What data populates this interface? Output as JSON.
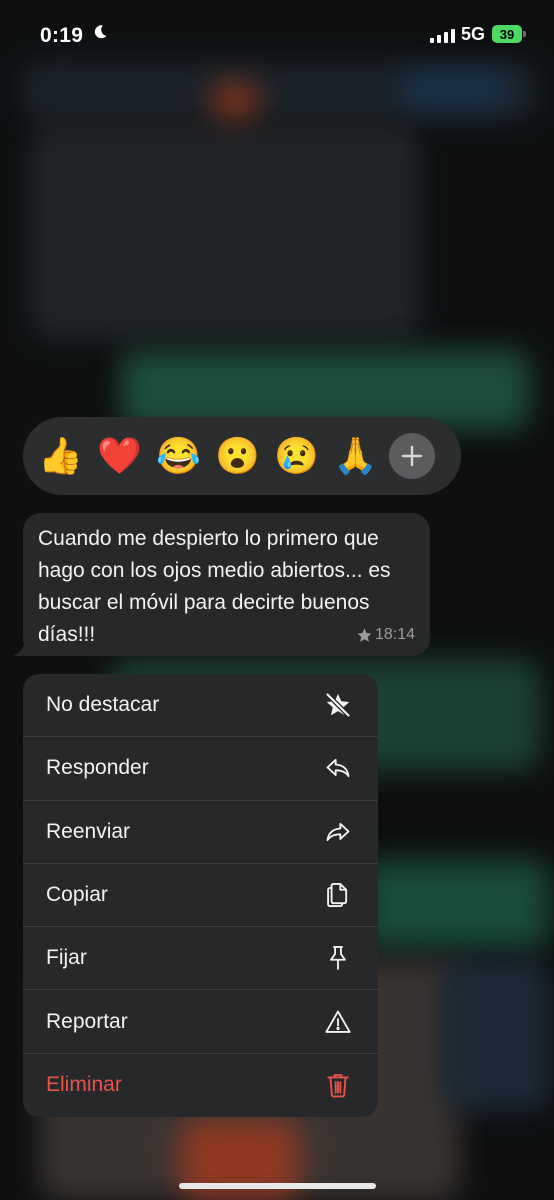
{
  "status_bar": {
    "time": "0:19",
    "network": "5G",
    "battery": "39"
  },
  "reactions": [
    {
      "emoji": "👍",
      "name": "thumbs-up"
    },
    {
      "emoji": "❤️",
      "name": "heart"
    },
    {
      "emoji": "😂",
      "name": "laughing"
    },
    {
      "emoji": "😮",
      "name": "surprised"
    },
    {
      "emoji": "😢",
      "name": "crying"
    },
    {
      "emoji": "🙏",
      "name": "pray"
    }
  ],
  "message": {
    "text": "Cuando me despierto lo primero que hago con los ojos medio abiertos... es buscar el móvil para decirte buenos días!!!",
    "time": "18:14",
    "starred": true
  },
  "menu": {
    "items": [
      {
        "label": "No destacar",
        "icon": "unstar-icon"
      },
      {
        "label": "Responder",
        "icon": "reply-icon"
      },
      {
        "label": "Reenviar",
        "icon": "forward-icon"
      },
      {
        "label": "Copiar",
        "icon": "copy-icon"
      },
      {
        "label": "Fijar",
        "icon": "pin-icon"
      },
      {
        "label": "Reportar",
        "icon": "warning-icon"
      },
      {
        "label": "Eliminar",
        "icon": "trash-icon"
      }
    ]
  },
  "colors": {
    "danger": "#e8544a",
    "battery": "#4cd964",
    "bubble": "#262829"
  }
}
